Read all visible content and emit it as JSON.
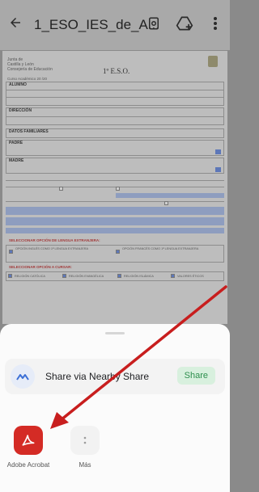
{
  "appbar": {
    "title": "1_ESO_IES_de_A...",
    "back_icon": "arrow-left-icon",
    "actions": [
      "document-search-icon",
      "drive-upload-icon",
      "more-vertical-icon"
    ]
  },
  "document": {
    "header": [
      "Junta de",
      "Castilla y León",
      "Consejería de Educación"
    ],
    "grade": "1º E.S.O.",
    "course_label": "Curso Académico 20    /20",
    "sections": [
      "ALUMNO",
      "DIRECCIÓN",
      "DATOS FAMILIARES",
      "PADRE",
      "MADRE"
    ],
    "option_lang": "SELECCIONAR OPCIÓN DE LENGUA EXTRANJERA:",
    "lang_a": "OPCIÓN INGLÉS COMO 1ª LENGUA EXTRANJERA",
    "lang_b": "OPCIÓN FRANCÉS COMO 1ª LENGUA EXTRANJERA",
    "option_subject": "SELECCIONAR OPCIÓN A CURSAR:",
    "subjects": [
      "RELIGIÓN CATÓLICA",
      "RELIGIÓN EVANGÉLICA",
      "RELIGIÓN ISLÁMICA",
      "VALORES ÉTICOS"
    ]
  },
  "sheet": {
    "nearby_label": "Share via Nearby Share",
    "nearby_button": "Share",
    "apps": [
      {
        "name": "Adobe Acrobat",
        "icon": "adobe-acrobat-icon"
      },
      {
        "name": "Más",
        "icon": "more-dots-icon"
      }
    ]
  },
  "colors": {
    "acrobat_red": "#d42b25",
    "share_green": "#2e8f4e",
    "annotation_arrow": "#c81e1e"
  }
}
